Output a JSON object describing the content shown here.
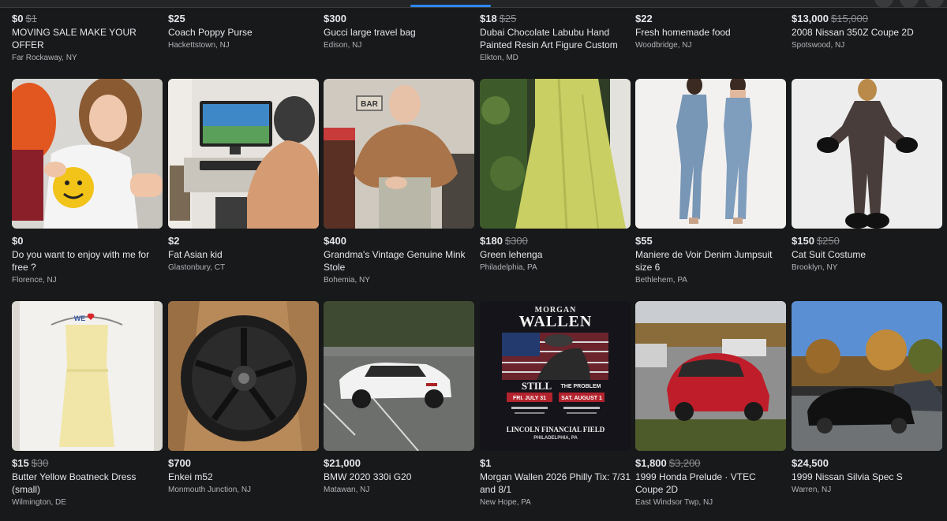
{
  "listings_top": [
    {
      "price": "$0",
      "original": "$1",
      "title": "MOVING SALE MAKE YOUR OFFER",
      "location": "Far Rockaway, NY"
    },
    {
      "price": "$25",
      "original": "",
      "title": "Coach Poppy Purse",
      "location": "Hackettstown, NJ"
    },
    {
      "price": "$300",
      "original": "",
      "title": "Gucci large travel bag",
      "location": "Edison, NJ"
    },
    {
      "price": "$18",
      "original": "$25",
      "title": "Dubai Chocolate Labubu Hand Painted Resin Art Figure Custom",
      "location": "Elkton, MD"
    },
    {
      "price": "$22",
      "original": "",
      "title": "Fresh homemade food",
      "location": "Woodbridge, NJ"
    },
    {
      "price": "$13,000",
      "original": "$15,000",
      "title": "2008 Nissan 350Z Coupe 2D",
      "location": "Spotswood, NJ"
    }
  ],
  "listings_middle": [
    {
      "price": "$0",
      "original": "",
      "title": "Do you want to enjoy with me for free ?",
      "location": "Florence, NJ",
      "image": "selfie-photo"
    },
    {
      "price": "$2",
      "original": "",
      "title": "Fat Asian kid",
      "location": "Glastonbury, CT",
      "image": "gaming-desk-photo"
    },
    {
      "price": "$400",
      "original": "",
      "title": "Grandma's Vintage Genuine Mink Stole",
      "location": "Bohemia, NY",
      "image": "mink-stole-photo"
    },
    {
      "price": "$180",
      "original": "$300",
      "title": "Green lehenga",
      "location": "Philadelphia, PA",
      "image": "green-dress-photo"
    },
    {
      "price": "$55",
      "original": "",
      "title": "Maniere de Voir Denim Jumpsuit size 6",
      "location": "Bethlehem, PA",
      "image": "denim-jumpsuit-photo"
    },
    {
      "price": "$150",
      "original": "$250",
      "title": "Cat Suit Costume",
      "location": "Brooklyn, NY",
      "image": "cat-suit-photo"
    }
  ],
  "listings_bottom": [
    {
      "price": "$15",
      "original": "$30",
      "title": "Butter Yellow Boatneck Dress (small)",
      "location": "Wilmington, DE",
      "image": "yellow-dress-photo",
      "hanger_text": "WE"
    },
    {
      "price": "$700",
      "original": "",
      "title": "Enkei m52",
      "location": "Monmouth Junction, NJ",
      "image": "wheel-photo"
    },
    {
      "price": "$21,000",
      "original": "",
      "title": "BMW 2020 330i G20",
      "location": "Matawan, NJ",
      "image": "bmw-photo"
    },
    {
      "price": "$1",
      "original": "",
      "title": "Morgan Wallen 2026 Philly Tix: 7/31 and 8/1",
      "location": "New Hope, PA",
      "image": "concert-poster",
      "poster": {
        "top": "MORGAN",
        "name": "WALLEN",
        "tour_a": "STILL",
        "tour_b": "THE PROBLEM",
        "date1": "FRI. JULY 31",
        "date2": "SAT. AUGUST 1",
        "venue": "LINCOLN FINANCIAL FIELD",
        "city": "PHILADELPHIA, PA"
      }
    },
    {
      "price": "$1,800",
      "original": "$3,200",
      "title": "1999 Honda Prelude · VTEC Coupe 2D",
      "location": "East Windsor Twp, NJ",
      "image": "honda-photo"
    },
    {
      "price": "$24,500",
      "original": "",
      "title": "1999 Nissan Silvia Spec S",
      "location": "Warren, NJ",
      "image": "silvia-photo"
    }
  ],
  "photo_sign": "BAR",
  "colors": {
    "background": "#18191a",
    "text": "#e4e6eb",
    "muted": "#b0b3b8",
    "accent": "#2d88ff"
  }
}
